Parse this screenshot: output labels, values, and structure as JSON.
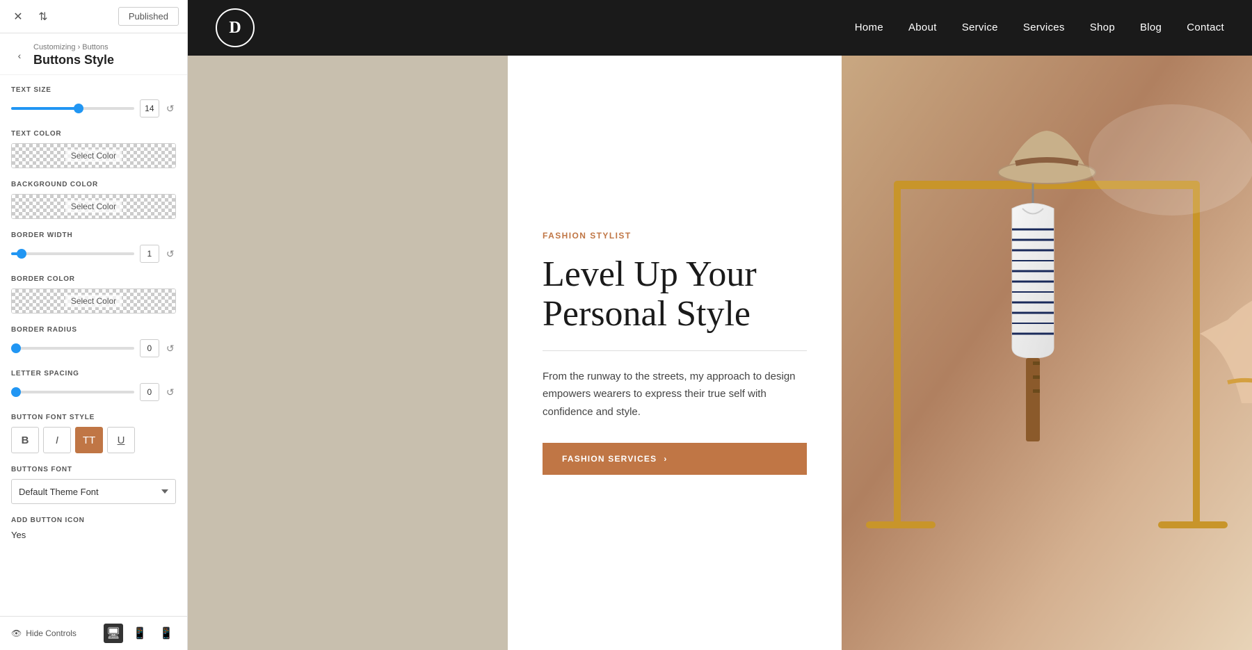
{
  "topBar": {
    "publishedLabel": "Published"
  },
  "panel": {
    "breadcrumb": "Customizing › Buttons",
    "title": "Buttons Style",
    "controls": {
      "textSize": {
        "label": "TEXT SIZE",
        "value": "14",
        "fillPercent": "55"
      },
      "textColor": {
        "label": "TEXT COLOR",
        "selectLabel": "Select Color"
      },
      "bgColor": {
        "label": "BACKGROUND COLOR",
        "selectLabel": "Select Color"
      },
      "borderWidth": {
        "label": "BORDER WIDTH",
        "value": "1",
        "fillPercent": "5"
      },
      "borderColor": {
        "label": "BORDER COLOR",
        "selectLabel": "Select Color"
      },
      "borderRadius": {
        "label": "BORDER RADIUS",
        "value": "0",
        "fillPercent": "0"
      },
      "letterSpacing": {
        "label": "LETTER SPACING",
        "value": "0",
        "fillPercent": "0"
      },
      "buttonFontStyle": {
        "label": "BUTTON FONT STYLE",
        "bold": "B",
        "italic": "I",
        "tt": "TT",
        "underline": "U"
      },
      "buttonsFont": {
        "label": "BUTTONS FONT",
        "value": "Default Theme Font"
      },
      "addButtonIcon": {
        "label": "ADD BUTTON ICON",
        "value": "Yes"
      }
    },
    "footer": {
      "hideControls": "Hide Controls"
    }
  },
  "nav": {
    "logoLetter": "D",
    "links": [
      "Home",
      "About",
      "Service",
      "Services",
      "Shop",
      "Blog",
      "Contact"
    ]
  },
  "hero": {
    "fashionLabel": "FASHION STYLIST",
    "titleLine1": "Level Up Your",
    "titleLine2": "Personal Style",
    "description": "From the runway to the streets, my approach to design empowers wearers to express their true self with confidence and style.",
    "ctaButton": "FASHION SERVICES",
    "ctaArrow": "›"
  }
}
